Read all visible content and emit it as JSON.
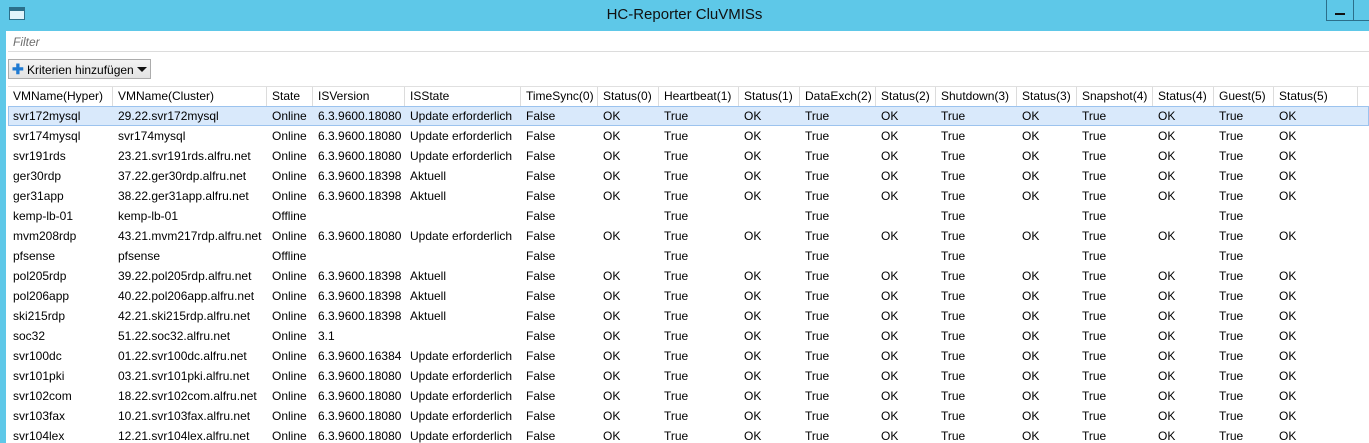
{
  "window": {
    "title": "HC-Reporter CluVMISs"
  },
  "filter": {
    "placeholder": "Filter"
  },
  "toolbar": {
    "criteria_label": "Kriterien hinzufügen"
  },
  "table": {
    "columns": [
      "VMName(Hyper)",
      "VMName(Cluster)",
      "State",
      "ISVersion",
      "ISState",
      "TimeSync(0)",
      "Status(0)",
      "Heartbeat(1)",
      "Status(1)",
      "DataExch(2)",
      "Status(2)",
      "Shutdown(3)",
      "Status(3)",
      "Snapshot(4)",
      "Status(4)",
      "Guest(5)",
      "Status(5)"
    ],
    "rows": [
      [
        "svr172mysql",
        "29.22.svr172mysql",
        "Online",
        "6.3.9600.18080",
        "Update erforderlich",
        "False",
        "OK",
        "True",
        "OK",
        "True",
        "OK",
        "True",
        "OK",
        "True",
        "OK",
        "True",
        "OK"
      ],
      [
        "svr174mysql",
        "svr174mysql",
        "Online",
        "6.3.9600.18080",
        "Update erforderlich",
        "False",
        "OK",
        "True",
        "OK",
        "True",
        "OK",
        "True",
        "OK",
        "True",
        "OK",
        "True",
        "OK"
      ],
      [
        "svr191rds",
        "23.21.svr191rds.alfru.net",
        "Online",
        "6.3.9600.18080",
        "Update erforderlich",
        "False",
        "OK",
        "True",
        "OK",
        "True",
        "OK",
        "True",
        "OK",
        "True",
        "OK",
        "True",
        "OK"
      ],
      [
        "ger30rdp",
        "37.22.ger30rdp.alfru.net",
        "Online",
        "6.3.9600.18398",
        "Aktuell",
        "False",
        "OK",
        "True",
        "OK",
        "True",
        "OK",
        "True",
        "OK",
        "True",
        "OK",
        "True",
        "OK"
      ],
      [
        "ger31app",
        "38.22.ger31app.alfru.net",
        "Online",
        "6.3.9600.18398",
        "Aktuell",
        "False",
        "OK",
        "True",
        "OK",
        "True",
        "OK",
        "True",
        "OK",
        "True",
        "OK",
        "True",
        "OK"
      ],
      [
        "kemp-lb-01",
        "kemp-lb-01",
        "Offline",
        "",
        "",
        "False",
        "",
        "True",
        "",
        "True",
        "",
        "True",
        "",
        "True",
        "",
        "True",
        ""
      ],
      [
        "mvm208rdp",
        "43.21.mvm217rdp.alfru.net",
        "Online",
        "6.3.9600.18080",
        "Update erforderlich",
        "False",
        "OK",
        "True",
        "OK",
        "True",
        "OK",
        "True",
        "OK",
        "True",
        "OK",
        "True",
        "OK"
      ],
      [
        "pfsense",
        "pfsense",
        "Offline",
        "",
        "",
        "False",
        "",
        "True",
        "",
        "True",
        "",
        "True",
        "",
        "True",
        "",
        "True",
        ""
      ],
      [
        "pol205rdp",
        "39.22.pol205rdp.alfru.net",
        "Online",
        "6.3.9600.18398",
        "Aktuell",
        "False",
        "OK",
        "True",
        "OK",
        "True",
        "OK",
        "True",
        "OK",
        "True",
        "OK",
        "True",
        "OK"
      ],
      [
        "pol206app",
        "40.22.pol206app.alfru.net",
        "Online",
        "6.3.9600.18398",
        "Aktuell",
        "False",
        "OK",
        "True",
        "OK",
        "True",
        "OK",
        "True",
        "OK",
        "True",
        "OK",
        "True",
        "OK"
      ],
      [
        "ski215rdp",
        "42.21.ski215rdp.alfru.net",
        "Online",
        "6.3.9600.18398",
        "Aktuell",
        "False",
        "OK",
        "True",
        "OK",
        "True",
        "OK",
        "True",
        "OK",
        "True",
        "OK",
        "True",
        "OK"
      ],
      [
        "soc32",
        "51.22.soc32.alfru.net",
        "Online",
        "3.1",
        "",
        "False",
        "OK",
        "True",
        "OK",
        "True",
        "OK",
        "True",
        "OK",
        "True",
        "OK",
        "True",
        "OK"
      ],
      [
        "svr100dc",
        "01.22.svr100dc.alfru.net",
        "Online",
        "6.3.9600.16384",
        "Update erforderlich",
        "False",
        "OK",
        "True",
        "OK",
        "True",
        "OK",
        "True",
        "OK",
        "True",
        "OK",
        "True",
        "OK"
      ],
      [
        "svr101pki",
        "03.21.svr101pki.alfru.net",
        "Online",
        "6.3.9600.18080",
        "Update erforderlich",
        "False",
        "OK",
        "True",
        "OK",
        "True",
        "OK",
        "True",
        "OK",
        "True",
        "OK",
        "True",
        "OK"
      ],
      [
        "svr102com",
        "18.22.svr102com.alfru.net",
        "Online",
        "6.3.9600.18080",
        "Update erforderlich",
        "False",
        "OK",
        "True",
        "OK",
        "True",
        "OK",
        "True",
        "OK",
        "True",
        "OK",
        "True",
        "OK"
      ],
      [
        "svr103fax",
        "10.21.svr103fax.alfru.net",
        "Online",
        "6.3.9600.18080",
        "Update erforderlich",
        "False",
        "OK",
        "True",
        "OK",
        "True",
        "OK",
        "True",
        "OK",
        "True",
        "OK",
        "True",
        "OK"
      ],
      [
        "svr104lex",
        "12.21.svr104lex.alfru.net",
        "Online",
        "6.3.9600.18080",
        "Update erforderlich",
        "False",
        "OK",
        "True",
        "OK",
        "True",
        "OK",
        "True",
        "OK",
        "True",
        "OK",
        "True",
        "OK"
      ]
    ]
  }
}
